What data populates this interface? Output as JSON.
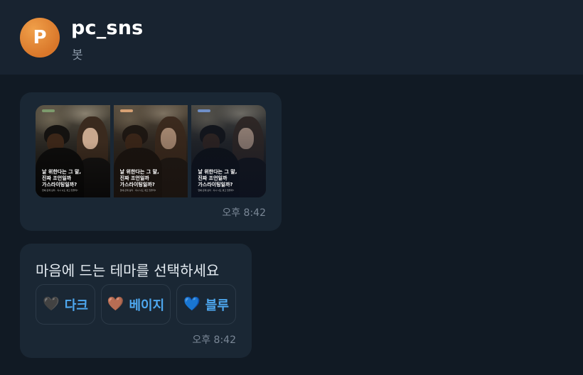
{
  "header": {
    "avatar_letter": "P",
    "title": "pc_sns",
    "subtitle": "봇"
  },
  "messages": [
    {
      "type": "images",
      "images": [
        {
          "caption": "날 위한다는 그 말,\n진짜 조언일까\n가스라이팅일까?",
          "small": "연애·관계 심리 · 혹시 나도 겪고 있을까?",
          "tint": "neutral"
        },
        {
          "caption": "날 위한다는 그 말,\n진짜 조언일까\n가스라이팅일까?",
          "small": "연애·관계 심리 · 혹시 나도 겪고 있을까?",
          "tint": "beige"
        },
        {
          "caption": "날 위한다는 그 말,\n진짜 조언일까\n가스라이팅일까?",
          "small": "연애·관계 심리 · 혹시 나도 겪고 있을까?",
          "tint": "blue"
        }
      ],
      "time": "오후 8:42"
    },
    {
      "type": "theme_select",
      "prompt": "마음에 드는 테마를 선택하세요",
      "buttons": [
        {
          "icon": "dark-heart-icon",
          "emoji": "🖤",
          "label": "다크",
          "color": "#4a2f5a"
        },
        {
          "icon": "beige-heart-icon",
          "emoji": "🤎",
          "label": "베이지",
          "color": "#c9776b"
        },
        {
          "icon": "blue-heart-icon",
          "emoji": "💙",
          "label": "블루",
          "color": "#2f7fe0"
        }
      ],
      "time": "오후 8:42"
    }
  ],
  "colors": {
    "background": "#111a24",
    "header": "#182330",
    "bubble": "#1a2734",
    "accent": "#4ea8f0",
    "avatar": "#e0832f"
  }
}
